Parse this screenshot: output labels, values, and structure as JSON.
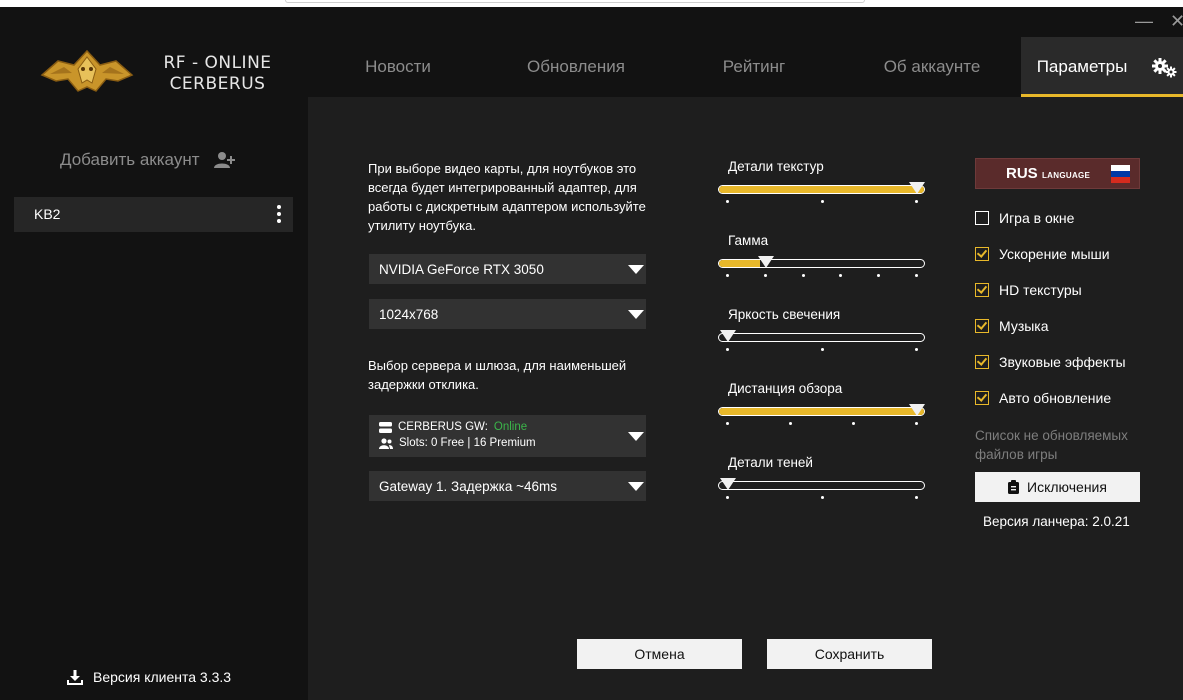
{
  "window": {
    "minimize_glyph": "—",
    "close_glyph": "✕"
  },
  "brand": {
    "line1": "RF - ONLINE",
    "line2": "CERBERUS"
  },
  "nav": {
    "tabs": [
      {
        "label": "Новости"
      },
      {
        "label": "Обновления"
      },
      {
        "label": "Рейтинг"
      },
      {
        "label": "Об аккаунте"
      },
      {
        "label": "Параметры",
        "active": true
      }
    ],
    "settings_icon": "gears-icon"
  },
  "sidebar": {
    "add_account_label": "Добавить аккаунт",
    "add_account_icon": "user-plus-icon",
    "accounts": [
      {
        "name": "KB2"
      }
    ],
    "client_version": "Версия клиента 3.3.3",
    "download_icon": "download-icon"
  },
  "settings": {
    "gpu_hint": "При выборе видео карты, для ноутбуков это всегда будет интегрированный адаптер, для работы с дискретным адаптером используйте утилиту ноутбука.",
    "gpu_value": "NVIDIA GeForce RTX 3050",
    "resolution_value": "1024x768",
    "server_hint": "Выбор сервера и шлюза, для наименьшей задержки отклика.",
    "server": {
      "name": "CERBERUS GW:",
      "status": "Online",
      "slots": "Slots: 0 Free | 16 Premium"
    },
    "gateway_value": "Gateway 1. Задержка ~46ms",
    "sliders": [
      {
        "label": "Детали текстур",
        "level": 1.0,
        "steps": 3
      },
      {
        "label": "Гамма",
        "level": 0.2,
        "steps": 6
      },
      {
        "label": "Яркость свечения",
        "level": 0.0,
        "steps": 3
      },
      {
        "label": "Дистанция обзора",
        "level": 1.0,
        "steps": 4
      },
      {
        "label": "Детали теней",
        "level": 0.0,
        "steps": 3
      }
    ],
    "language": {
      "code": "RUS",
      "caption": "LANGUAGE",
      "flag": "russia-flag",
      "flag_colors": [
        "#ffffff",
        "#0039a6",
        "#d52b1e"
      ]
    },
    "checkboxes": [
      {
        "label": "Игра в окне",
        "checked": false
      },
      {
        "label": "Ускорение мыши",
        "checked": true
      },
      {
        "label": "HD текстуры",
        "checked": true
      },
      {
        "label": "Музыка",
        "checked": true
      },
      {
        "label": "Звуковые эффекты",
        "checked": true
      },
      {
        "label": "Авто обновление",
        "checked": true
      }
    ],
    "excluded_note": "Список не обновляемых файлов игры",
    "exclusions_button": "Исключения",
    "launcher_version": "Версия ланчера: 2.0.21",
    "cancel_button": "Отмена",
    "save_button": "Сохранить"
  },
  "colors": {
    "accent": "#e8b82a",
    "background": "#121212",
    "panel": "#1e1e1e",
    "control": "#323232",
    "online": "#3bb54a",
    "language_bg": "#5a2b2b"
  }
}
